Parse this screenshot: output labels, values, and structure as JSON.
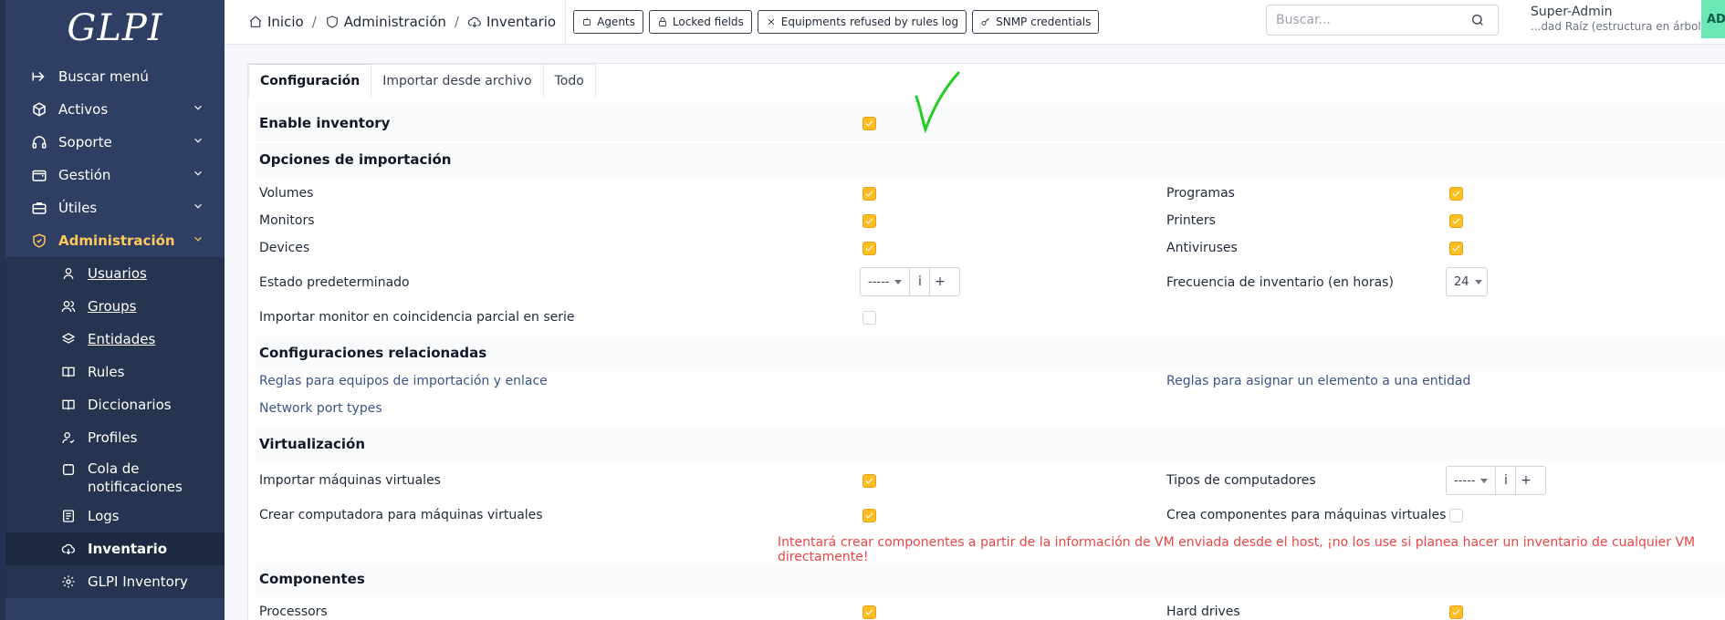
{
  "app": {
    "logo": "GLPI"
  },
  "sidebar": {
    "items": [
      {
        "label": "Buscar menú",
        "icon": "arrow-right-icon"
      },
      {
        "label": "Activos",
        "icon": "box-icon"
      },
      {
        "label": "Soporte",
        "icon": "headset-icon"
      },
      {
        "label": "Gestión",
        "icon": "wallet-icon"
      },
      {
        "label": "Útiles",
        "icon": "briefcase-icon"
      },
      {
        "label": "Administración",
        "icon": "shield-icon"
      }
    ],
    "subitems": [
      {
        "label": "Usuarios",
        "icon": "user-icon"
      },
      {
        "label": "Groups",
        "icon": "users-icon"
      },
      {
        "label": "Entidades",
        "icon": "layers-icon"
      },
      {
        "label": "Rules",
        "icon": "book-icon"
      },
      {
        "label": "Diccionarios",
        "icon": "book-icon"
      },
      {
        "label": "Profiles",
        "icon": "user-check-icon"
      },
      {
        "label": "Cola de notificaciones",
        "icon": "bell-icon"
      },
      {
        "label": "Logs",
        "icon": "log-icon"
      },
      {
        "label": "Inventario",
        "icon": "cloud-download-icon"
      },
      {
        "label": "GLPI Inventory",
        "icon": "gear-icon"
      }
    ]
  },
  "breadcrumb": {
    "home": "Inicio",
    "admin": "Administración",
    "current": "Inventario"
  },
  "header_buttons": [
    {
      "label": "Agents",
      "icon": "robot-icon"
    },
    {
      "label": "Locked fields",
      "icon": "lock-icon"
    },
    {
      "label": "Equipments refused by rules log",
      "icon": "x-icon"
    },
    {
      "label": "SNMP credentials",
      "icon": "key-icon"
    }
  ],
  "search": {
    "placeholder": "Buscar..."
  },
  "user": {
    "name": "Super-Admin",
    "entity": "...dad Raíz (estructura en árbol)",
    "avatar": "AD"
  },
  "tabs": [
    "Configuración",
    "Importar desde archivo",
    "Todo"
  ],
  "form": {
    "enable_inventory": "Enable inventory",
    "sections": {
      "import_options": "Opciones de importación",
      "related": "Configuraciones relacionadas",
      "virtualization": "Virtualización",
      "components": "Componentes"
    },
    "left": {
      "volumes": "Volumes",
      "monitors": "Monitors",
      "devices": "Devices",
      "default_state": "Estado predeterminado",
      "partial_serial": "Importar monitor en coincidencia parcial en serie",
      "import_vms": "Importar máquinas virtuales",
      "create_vm_computer": "Crear computadora para máquinas virtuales",
      "processors": "Processors"
    },
    "right": {
      "software": "Programas",
      "printers": "Printers",
      "antivirus": "Antiviruses",
      "frequency": "Frecuencia de inventario (en horas)",
      "computer_types": "Tipos de computadores",
      "vm_components": "Crea componentes para máquinas virtuales",
      "hard_drives": "Hard drives"
    },
    "links": {
      "import_rules": "Reglas para equipos de importación y enlace",
      "entity_rules": "Reglas para asignar un elemento a una entidad",
      "port_types": "Network port types"
    },
    "dropdown_empty": "-----",
    "info_btn": "i",
    "add_btn": "+",
    "frequency_value": "24",
    "warning": "Intentará crear componentes a partir de la información de VM enviada desde el host, ¡no los use si planea hacer un inventario de cualquier VM directamente!"
  },
  "colors": {
    "sidebar": "#2f3f64",
    "accent": "#fec95c",
    "checkbox": "#fbbf24",
    "warning": "#ef4444",
    "annotation": "#22cc22"
  }
}
